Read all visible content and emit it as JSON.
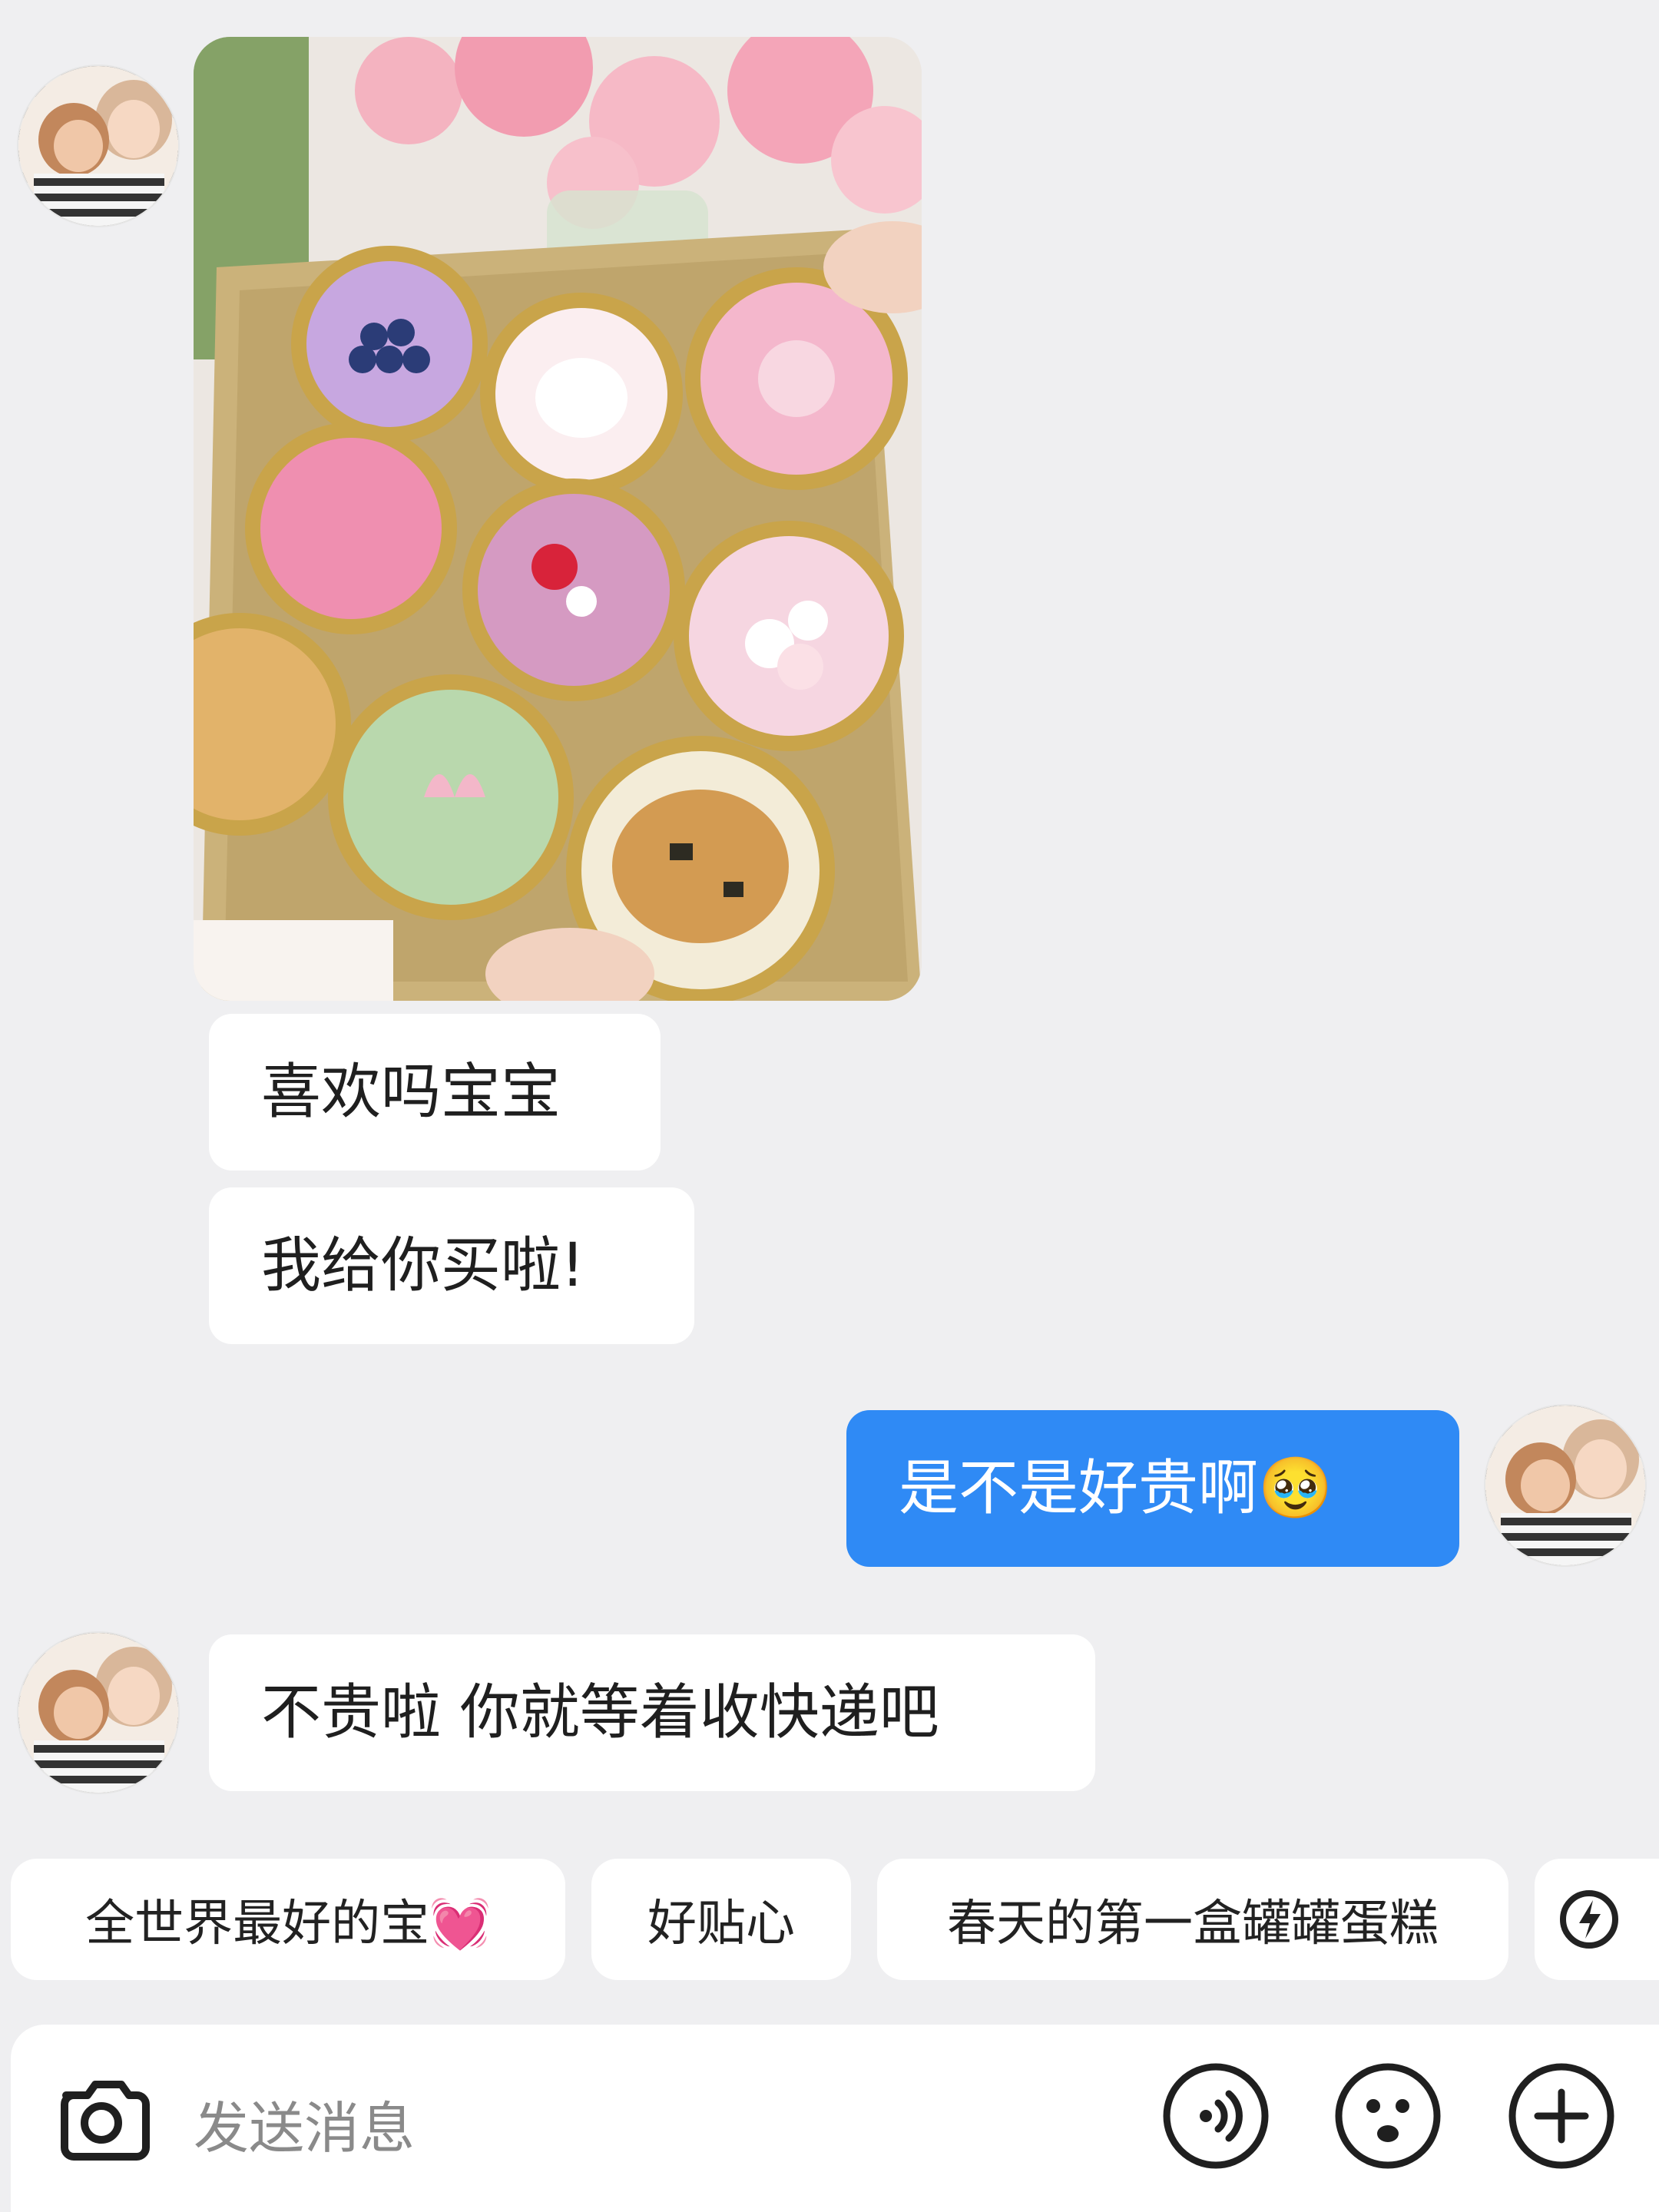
{
  "messages": {
    "m1": "喜欢吗宝宝",
    "m2": "我给你买啦!",
    "m3": "是不是好贵啊🥹",
    "m4": "不贵啦 你就等着收快递吧"
  },
  "quick_replies": {
    "r1": "全世界最好的宝💓",
    "r2": "好贴心",
    "r3": "春天的第一盒罐罐蛋糕"
  },
  "input": {
    "placeholder": "发送消息"
  },
  "icons": {
    "camera": "camera-icon",
    "voice": "voice-icon",
    "emoji": "emoji-icon",
    "plus": "plus-icon",
    "lightning": "lightning-icon"
  },
  "colors": {
    "background": "#efeff1",
    "my_bubble": "#2f8af5",
    "their_bubble": "#ffffff"
  }
}
